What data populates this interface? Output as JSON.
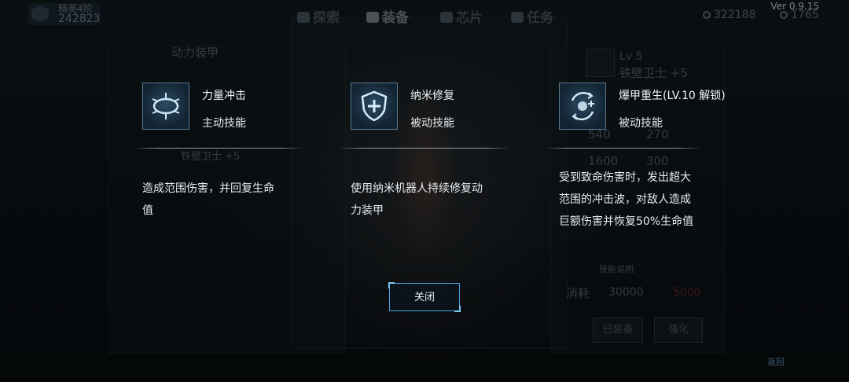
{
  "app": {
    "version": "Ver 0.9.15"
  },
  "topbar": {
    "rank_title": "精英4阶",
    "rank_score": "242823",
    "tabs": [
      {
        "label": "探索",
        "icon": "binoculars-icon"
      },
      {
        "label": "装备",
        "icon": "gun-icon"
      },
      {
        "label": "芯片",
        "icon": "chip-icon"
      },
      {
        "label": "任务",
        "icon": "task-icon"
      }
    ],
    "currency_credits": "322188",
    "currency_gems": "1765"
  },
  "background": {
    "armor_header": "动力装甲",
    "armor_name_left": "铁壁卫士 +5",
    "level_tag": "Lv 5",
    "armor_name_right": "铁壁卫士 +5",
    "stats_right": [
      "540",
      "270",
      "1600",
      "300"
    ],
    "skill_note": "技能说明",
    "cost_label": "消耗",
    "cost_credits": "30000",
    "cost_gems": "5000",
    "equipped_button": "已装备",
    "upgrade_button": "强化",
    "back_label": "返回"
  },
  "skills": [
    {
      "name": "力量冲击",
      "type": "主动技能",
      "desc_lines": [
        "造成范围伤害，并回复生命",
        "值"
      ],
      "icon": "shockwave-icon"
    },
    {
      "name": "纳米修复",
      "type": "被动技能",
      "desc_lines": [
        "使用纳米机器人持续修复动",
        "力装甲"
      ],
      "icon": "shield-plus-icon"
    },
    {
      "name": "爆甲重生(LV.10 解锁)",
      "type": "被动技能",
      "desc_lines": [
        "受到致命伤害时，发出超大",
        "范围的冲击波，对敌人造成",
        "巨额伤害并恢复50%生命值"
      ],
      "icon": "revive-icon"
    }
  ],
  "dialog": {
    "close_label": "关闭"
  },
  "colors": {
    "accent_border": "#4aa3d8",
    "icon_border": "#5d7a8c",
    "text_bright": "#f2f5f7"
  }
}
